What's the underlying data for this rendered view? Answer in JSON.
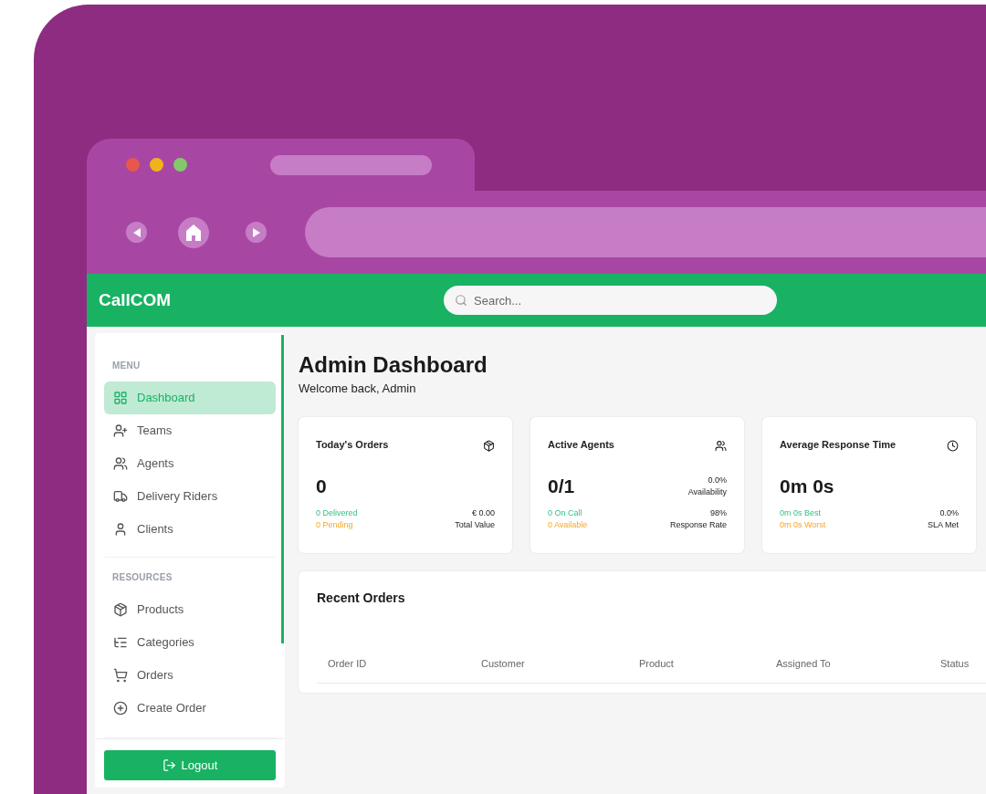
{
  "app": {
    "logo": "CallCOM",
    "search": {
      "placeholder": "Search..."
    }
  },
  "sidebar": {
    "sections": [
      {
        "heading": "MENU",
        "items": [
          {
            "label": "Dashboard",
            "selected": true
          },
          {
            "label": "Teams",
            "selected": false
          },
          {
            "label": "Agents",
            "selected": false
          },
          {
            "label": "Delivery Riders",
            "selected": false
          },
          {
            "label": "Clients",
            "selected": false
          }
        ]
      },
      {
        "heading": "RESOURCES",
        "items": [
          {
            "label": "Products",
            "selected": false
          },
          {
            "label": "Categories",
            "selected": false
          },
          {
            "label": "Orders",
            "selected": false
          },
          {
            "label": "Create Order",
            "selected": false
          }
        ]
      }
    ],
    "logout": "Logout"
  },
  "page": {
    "title": "Admin Dashboard",
    "subtitle": "Welcome back, Admin"
  },
  "cards": [
    {
      "title": "Today's Orders",
      "value": "0",
      "good": "0 Delivered",
      "warn": "0 Pending",
      "right_value": "€ 0.00",
      "right_label": "Total Value"
    },
    {
      "title": "Active Agents",
      "value": "0/1",
      "side": [
        "0.0%",
        "Availability"
      ],
      "good": "0 On Call",
      "warn": "0 Available",
      "right_value": "98%",
      "right_label": "Response Rate"
    },
    {
      "title": "Average Response Time",
      "value": "0m 0s",
      "good": "0m 0s Best",
      "warn": "0m 0s Worst",
      "right_value": "0.0%",
      "right_label": "SLA Met"
    }
  ],
  "recent_orders": {
    "title": "Recent Orders",
    "columns": [
      "Order ID",
      "Customer",
      "Product",
      "Assigned To",
      "Status"
    ]
  }
}
